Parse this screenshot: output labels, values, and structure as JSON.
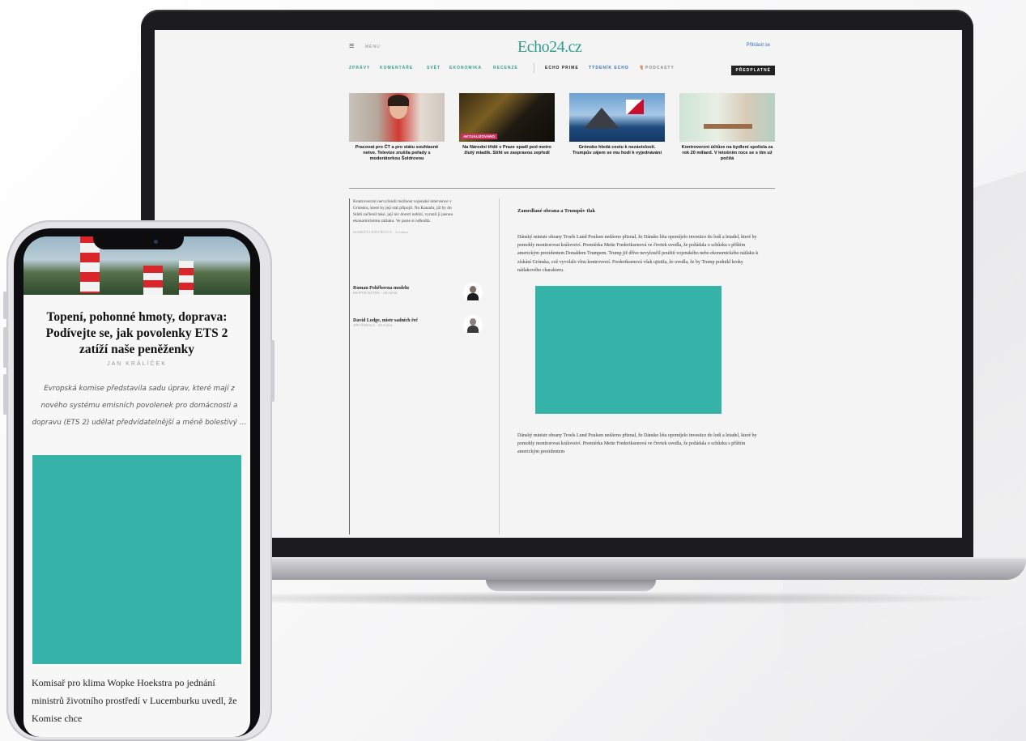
{
  "laptop": {
    "site": {
      "logo": "Echo24.cz",
      "menu_icon": "≡",
      "menu_label": "MENU",
      "login": "Přihlásit se",
      "subscribe": "PŘEDPLATNÉ",
      "nav": [
        {
          "label": "ZPRÁVY",
          "color": "#2f9c8c"
        },
        {
          "label": "KOMENTÁŘE",
          "color": "#2f9c8c"
        },
        {
          "label": "SVĚT",
          "color": "#2f9c8c"
        },
        {
          "label": "EKONOMIKA",
          "color": "#2f9c8c"
        },
        {
          "label": "RECENZE",
          "color": "#2f9c8c"
        },
        {
          "label": "ECHO PRIME",
          "color": "#222222"
        },
        {
          "label": "TÝDENÍK ECHO",
          "color": "#3070c0"
        },
        {
          "label": "PODCASTY",
          "color": "#888888"
        }
      ],
      "cards": [
        {
          "caption": "Pracovat pro ČT a pro státu souhlasně netve. Televize zrušila pořady s moderátorkou Šoldrovou",
          "tag": ""
        },
        {
          "caption": "Na Národní třídě v Praze spadl pod metro žlutý mladík. Stihl se zaspravou zepředí",
          "tag": "AKTUALIZOVÁNO"
        },
        {
          "caption": "Grónsko hledá cestu k nezávislosti. Trumpův zájem se mu hodí k vyjednávání",
          "tag": ""
        },
        {
          "caption": "Kontroverzní účtůze na bydlení spolisla za rok 20 miliard. V letošním roce se s tím už počítá",
          "tag": ""
        }
      ],
      "left_teaser": "Kontroverzní nervylonilí možnost vojenské intervence v Grónsku, které by její stát připojil. Na Kanadu, jíž by do Států začlenil také, její nic dorotl nabízí, vyrazil ji jasnou ekonomickému zátlaku. Ve jasne si odhodlá.",
      "left_teaser_meta": "MARKÉTA PAVLÍKOVÁ · 12 minut",
      "authors": [
        {
          "name": "Roman Pohřbovna modelu",
          "meta": "MARTIN BÁTEK · 25 minut"
        },
        {
          "name": "David Lodge, mistr sadních řeč",
          "meta": "JIŘÍ ŠVEHLA · 43 minut"
        }
      ],
      "article": {
        "heading": "Zamedlané obrana a Trumpův tlak",
        "para1": "Dánský ministr obrany Troels Lund Poulsen nedávno přiznal, že Dánsko léta opomíjelo investice do lodí a letadel, které by pomohly monitorovat království. Premiérka Mette Frederiksenová ve čtvrtek uvedla, že požádala o schůzku s příštím americkým prezidentem Donaldem Trumpem. Trump již dříve nevyloučil použití vojenského nebo ekonomického nátlaku k získání Grónska, což vyvolalo vlnu kontroverzí. Frederiksenová však ujistila, že uvedla, že by Trump podnikl kroky nátlakového charakteru.",
        "para2": "Dánský ministr obrany Troels Lund Poulsen nedávno přiznal, že Dánsko léta opomíjelo investice do lodí a letadel, které by pomohly monitorovat království. Premiérka Mette Frederiksenová ve čtvrtek uvedla, že požádala o schůzku s příštím americkým prezidentem"
      }
    }
  },
  "phone": {
    "title": "Topení, pohonné hmoty, doprava: Podívejte se, jak povolenky ETS 2 zatíží naše peněženky",
    "author": "JAN KRÁLÍČEK",
    "perex": "Evropská komise představila sadu úprav, které mají z nového systému emisních povolenek pro domácnosti a dopravu (ETS 2) udělat předvídatelnější a méně bolestivý …",
    "body": "Komisař pro klima Wopke Hoekstra po jednání ministrů životního prostředí v Lucemburku uvedl, že Komise chce"
  },
  "colors": {
    "accent": "#2f9c8c",
    "placeholder": "#35b3a8",
    "tag": "#d03060"
  }
}
